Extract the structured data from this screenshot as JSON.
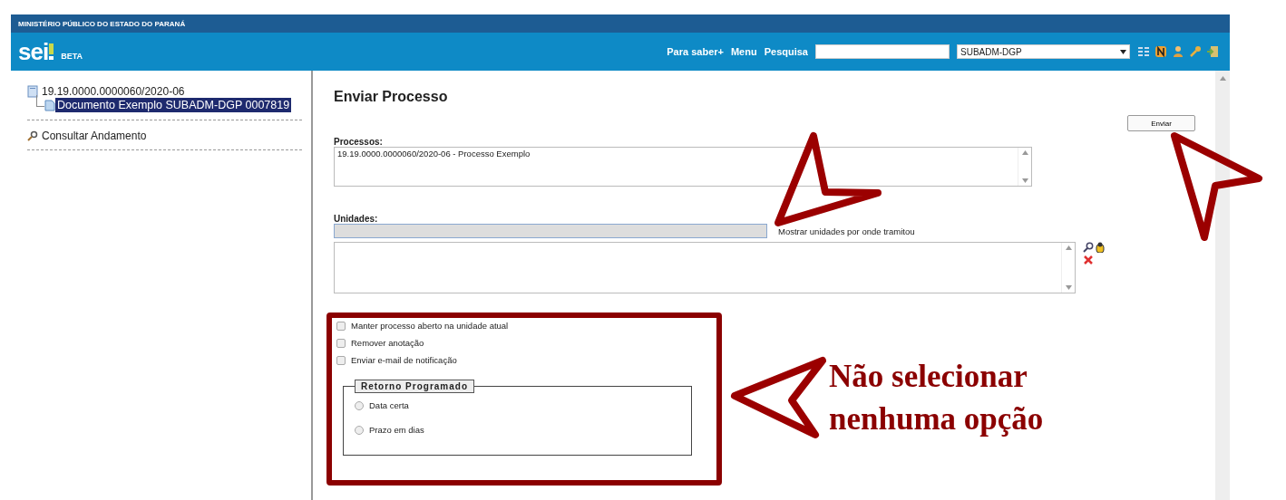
{
  "header": {
    "organization": "MINISTÉRIO PÚBLICO DO ESTADO DO PARANÁ",
    "logo": "sei",
    "badge": "BETA",
    "links": [
      "Para saber+",
      "Menu",
      "Pesquisa"
    ],
    "unit_select": {
      "value": "SUBADM-DGP"
    }
  },
  "tree": {
    "label": "19.19.0000.0000060/2020-06",
    "children": [
      {
        "label": "Documento Exemplo SUBADM-DGP 0007819",
        "selected": true
      }
    ]
  },
  "sidebar_link": "Consultar Andamento",
  "form": {
    "title": "Enviar Processo",
    "submit": "Enviar",
    "processes_label": "Processos:",
    "processes": [
      "19.19.0000.0000060/2020-06 - Processo Exemplo"
    ],
    "units_label": "Unidades:",
    "units_link": "Mostrar unidades por onde tramitou",
    "options": [
      {
        "label": "Manter processo aberto na unidade atual",
        "checked": false
      },
      {
        "label": "Remover anotação",
        "checked": false
      },
      {
        "label": "Enviar e-mail de notificação",
        "checked": false
      }
    ],
    "return_group": {
      "legend": "Retorno Programado",
      "choices": [
        {
          "label": "Data certa",
          "selected": false
        },
        {
          "label": "Prazo em dias",
          "selected": false
        }
      ]
    }
  },
  "annotation": {
    "text": "Não selecionar nenhuma opção"
  }
}
